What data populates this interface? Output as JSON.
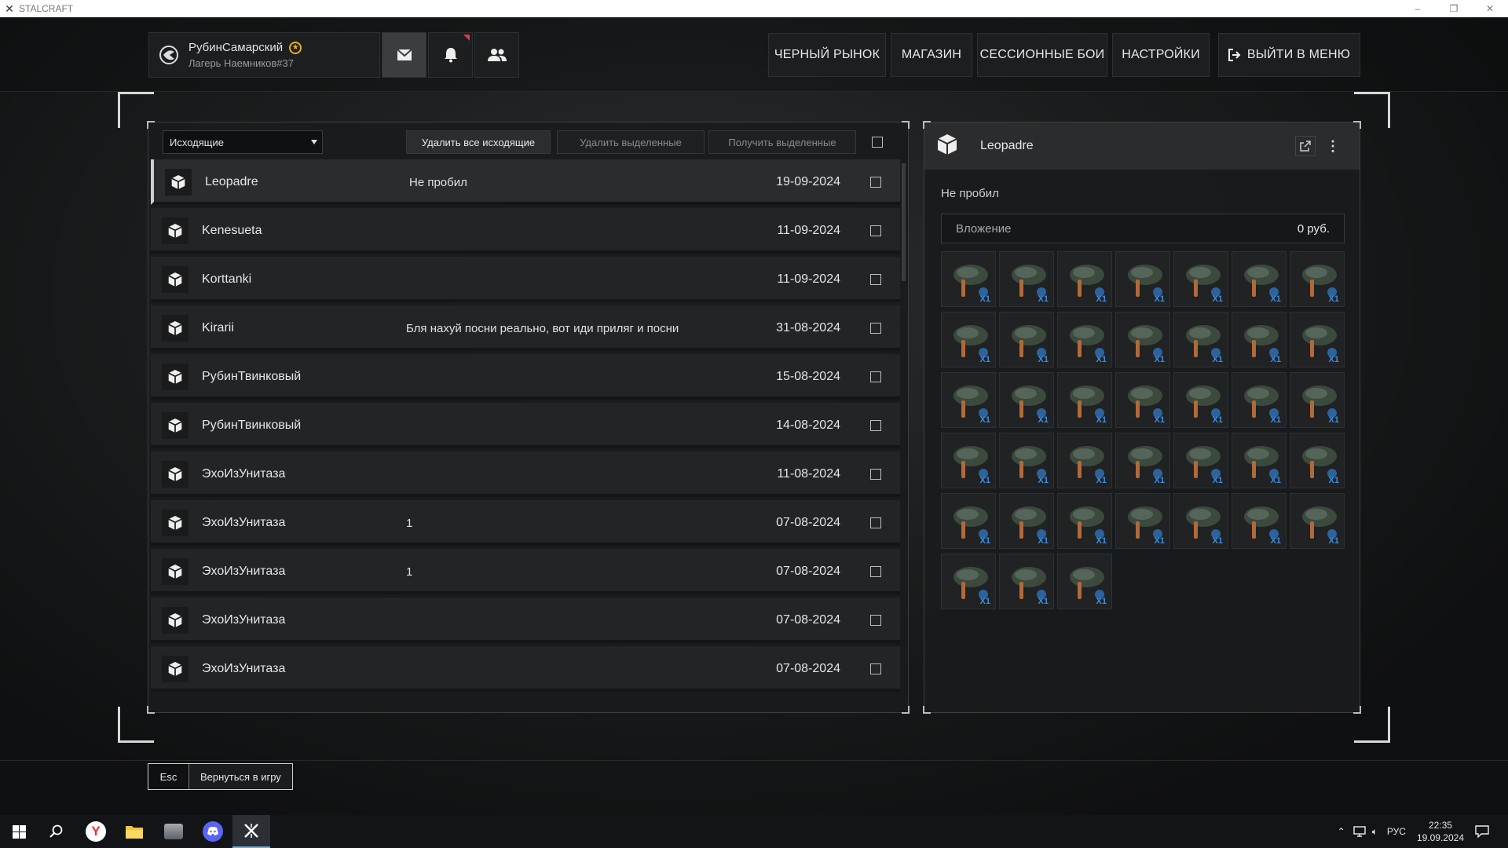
{
  "window": {
    "title": "STALCRAFT",
    "minimize": "–",
    "restore": "❐",
    "close": "✕"
  },
  "profile": {
    "name": "РубинСамарский",
    "subtitle": "Лагерь Наемников#37"
  },
  "nav": {
    "black_market": "ЧЕРНЫЙ РЫНОК",
    "shop": "МАГАЗИН",
    "session_battles": "СЕССИОННЫЕ БОИ",
    "settings": "НАСТРОЙКИ",
    "exit": "ВЫЙТИ В МЕНЮ"
  },
  "mail": {
    "filter_selected": "Исходящие",
    "delete_all_label": "Удалить все исходящие",
    "delete_selected_label": "Удалить выделенные",
    "receive_selected_label": "Получить выделенные",
    "rows": [
      {
        "name": "Leopadre",
        "message": "Не пробил",
        "date": "19-09-2024"
      },
      {
        "name": "Kenesueta",
        "message": "",
        "date": "11-09-2024"
      },
      {
        "name": "Korttanki",
        "message": "",
        "date": "11-09-2024"
      },
      {
        "name": "Kirarii",
        "message": "Бля нахуй посни реально, вот иди приляг и посни",
        "date": "31-08-2024"
      },
      {
        "name": "РубинТвинковый",
        "message": "",
        "date": "15-08-2024"
      },
      {
        "name": "РубинТвинковый",
        "message": "",
        "date": "14-08-2024"
      },
      {
        "name": "ЭхоИзУнитаза",
        "message": "",
        "date": "11-08-2024"
      },
      {
        "name": "ЭхоИзУнитаза",
        "message": "1",
        "date": "07-08-2024"
      },
      {
        "name": "ЭхоИзУнитаза",
        "message": "1",
        "date": "07-08-2024"
      },
      {
        "name": "ЭхоИзУнитаза",
        "message": "",
        "date": "07-08-2024"
      },
      {
        "name": "ЭхоИзУнитаза",
        "message": "",
        "date": "07-08-2024"
      }
    ]
  },
  "detail": {
    "recipient": "Leopadre",
    "message": "Не пробил",
    "attachment_label": "Вложение",
    "attachment_value": "0 руб.",
    "item_count_label": "X1",
    "item_slot_count": 38
  },
  "footer": {
    "esc_key": "Esc",
    "return_label": "Вернуться в игру"
  },
  "taskbar": {
    "language": "РУС",
    "time": "22:35",
    "date": "19.09.2024"
  },
  "colors": {
    "notification_dot": "#e03a3a",
    "star_badge": "#e2b21d",
    "item_count": "#3d8ee0"
  }
}
